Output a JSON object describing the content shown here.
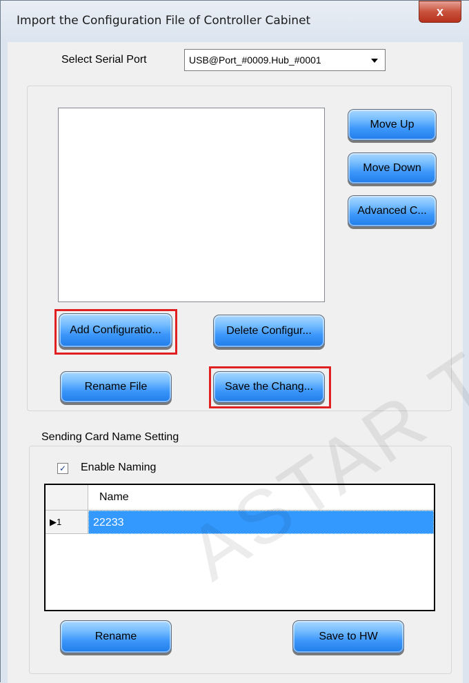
{
  "window": {
    "title": "Import the Configuration File of Controller Cabinet",
    "close_label": "x"
  },
  "serial_port": {
    "label": "Select Serial Port",
    "selected": "USB@Port_#0009.Hub_#0001"
  },
  "config_panel": {
    "buttons": {
      "move_up": "Move Up",
      "move_down": "Move Down",
      "advanced": "Advanced C...",
      "add_config": "Add Configuratio...",
      "delete_config": "Delete Configur...",
      "rename_file": "Rename File",
      "save_changes": "Save the Chang..."
    }
  },
  "naming": {
    "group_title": "Sending Card Name Setting",
    "enable_label": "Enable Naming",
    "enable_checked": true,
    "checkmark": "✓",
    "grid": {
      "column_header": "Name",
      "rows": [
        {
          "index": "1",
          "name": "22233"
        }
      ]
    },
    "buttons": {
      "rename": "Rename",
      "save_to_hw": "Save to HW"
    }
  },
  "watermark": "ASTAR TECH",
  "colors": {
    "button_blue": "#3d97fb",
    "highlight_red": "#e02020",
    "selection_blue": "#3399ff"
  }
}
